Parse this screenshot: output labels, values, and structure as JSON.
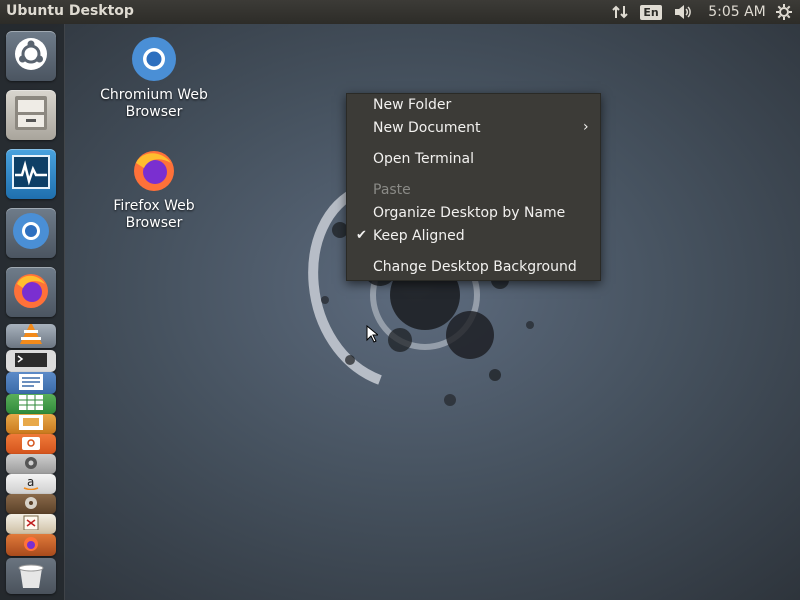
{
  "top_panel": {
    "title": "Ubuntu Desktop",
    "lang_indicator": "En",
    "clock": "5:05 AM",
    "icons": [
      "network-transfer-icon",
      "keyboard-language-icon",
      "volume-icon",
      "system-gear-icon"
    ]
  },
  "launcher": {
    "items": [
      "ubuntu-dash",
      "files",
      "system-monitor",
      "chromium",
      "firefox",
      "vlc",
      "terminal",
      "libreoffice-writer",
      "libreoffice-calc",
      "libreoffice-impress",
      "ubuntu-software",
      "amazon",
      "rhythmbox",
      "trash"
    ]
  },
  "desktop": {
    "icons": [
      {
        "label_line1": "Chromium Web",
        "label_line2": "Browser"
      },
      {
        "label_line1": "Firefox Web",
        "label_line2": "Browser"
      }
    ]
  },
  "context_menu": {
    "items": [
      {
        "label": "New Folder",
        "enabled": true
      },
      {
        "label": "New Document",
        "enabled": true,
        "submenu": true
      },
      {
        "label": "Open Terminal",
        "enabled": true
      },
      {
        "label": "Paste",
        "enabled": false
      },
      {
        "label": "Organize Desktop by Name",
        "enabled": true
      },
      {
        "label": "Keep Aligned",
        "enabled": true,
        "checked": true
      },
      {
        "label": "Change Desktop Background",
        "enabled": true
      }
    ],
    "check_glyph": "✔",
    "submenu_glyph": "›"
  },
  "colors": {
    "panel": "#3c3b37",
    "menu_bg": "#3c3b37",
    "menu_text": "#f2f1ef",
    "menu_disabled": "#8a8a86",
    "vlc_orange": "#f28a1b",
    "firefox_orange": "#ff7139"
  }
}
